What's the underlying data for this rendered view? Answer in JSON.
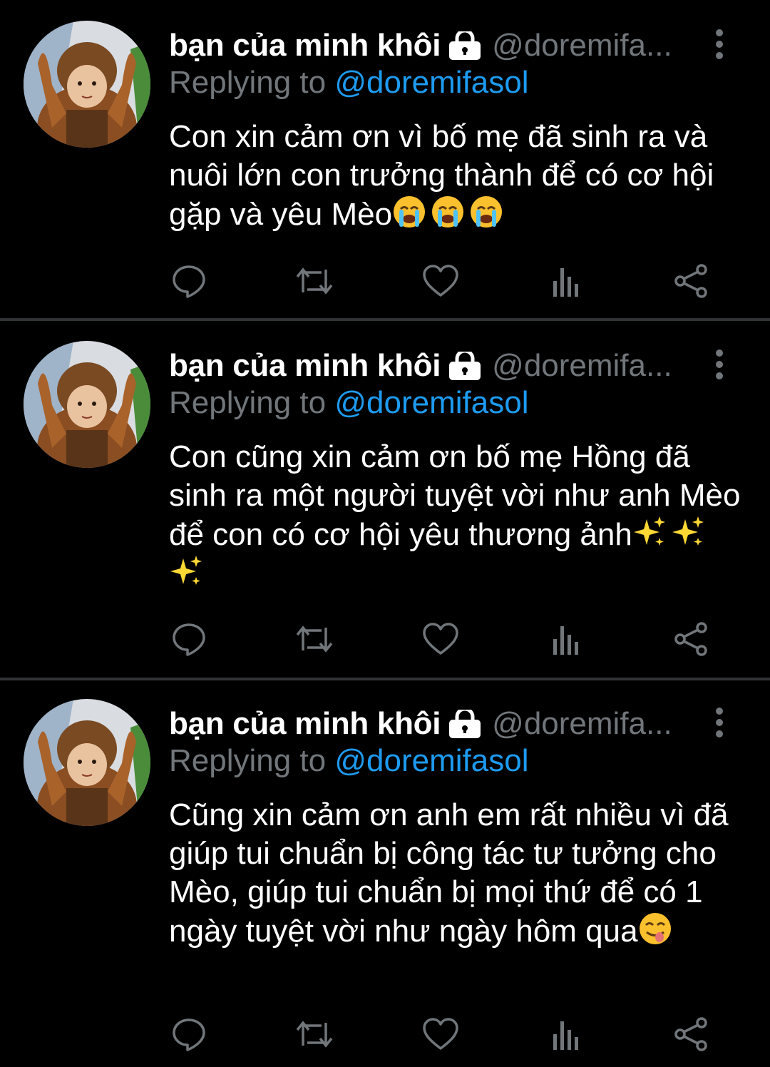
{
  "colors": {
    "background": "#000000",
    "text": "#ffffff",
    "muted": "#71767b",
    "accent": "#1d9bf0",
    "divider": "#2f3336"
  },
  "tweets": [
    {
      "display_name": "bạn của minh khôi",
      "handle": "@doremifa...",
      "reply_prefix": "Replying to",
      "reply_to": "@doremifasol",
      "text": "Con xin cảm ơn vì bố mẹ đã sinh ra và nuôi lớn con trưởng thành để có cơ hội gặp và yêu Mèo",
      "trailing_emoji": [
        "loudly-crying-face",
        "loudly-crying-face",
        "loudly-crying-face"
      ]
    },
    {
      "display_name": "bạn của minh khôi",
      "handle": "@doremifa...",
      "reply_prefix": "Replying to",
      "reply_to": "@doremifasol",
      "text": "Con cũng xin cảm ơn bố mẹ Hồng đã sinh ra một người tuyệt vời như anh Mèo để con có cơ hội yêu thương ảnh",
      "trailing_emoji": [
        "sparkles",
        "sparkles",
        "sparkles"
      ]
    },
    {
      "display_name": "bạn của minh khôi",
      "handle": "@doremifa...",
      "reply_prefix": "Replying to",
      "reply_to": "@doremifasol",
      "text": "Cũng xin cảm ơn anh em rất nhiều vì đã giúp tui chuẩn bị công tác tư tưởng cho Mèo, giúp tui chuẩn bị mọi thứ để có 1 ngày tuyệt vời như ngày hôm qua",
      "trailing_emoji": [
        "face-savoring-food"
      ]
    }
  ],
  "action_icons": [
    "reply-icon",
    "retweet-icon",
    "like-icon",
    "views-icon",
    "share-icon"
  ]
}
